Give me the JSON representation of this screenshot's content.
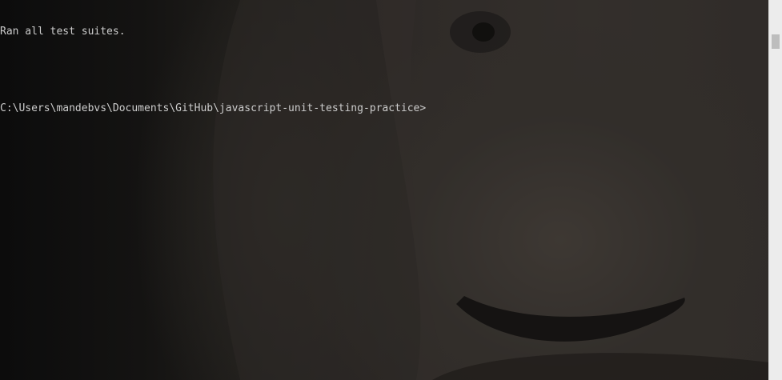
{
  "terminal": {
    "lines": [
      "Ran all test suites.",
      "",
      "C:\\Users\\mandebvs\\Documents\\GitHub\\javascript-unit-testing-practice>"
    ]
  }
}
